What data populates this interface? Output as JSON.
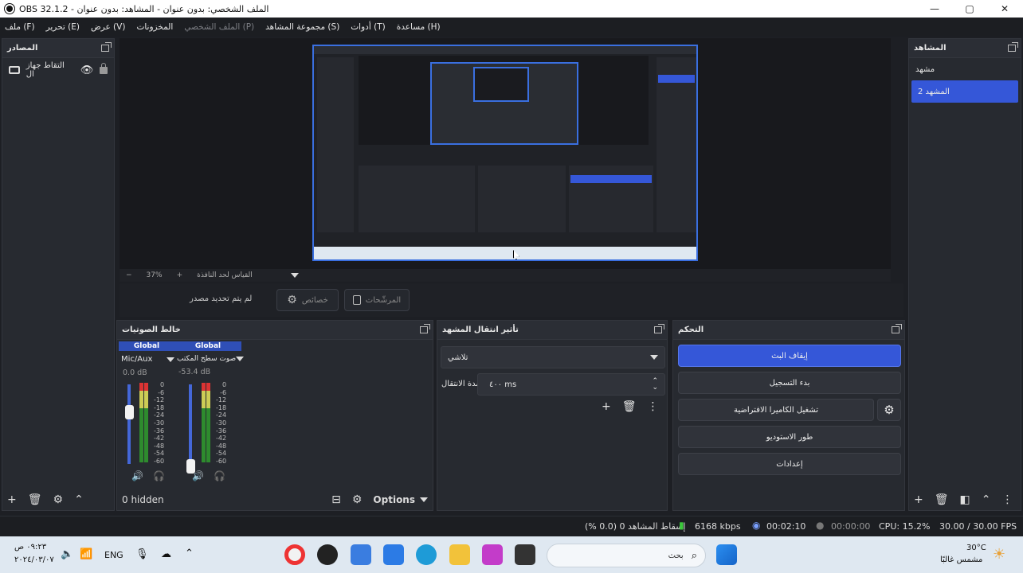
{
  "window": {
    "title": "OBS 32.1.2 - الملف الشخصي: بدون عنوان - المشاهد: بدون عنوان",
    "min_glyph": "—",
    "max_glyph": "▢",
    "close_glyph": "✕"
  },
  "menu": [
    {
      "label": "ملف (F)",
      "enabled": true
    },
    {
      "label": "تحرير (E)",
      "enabled": true
    },
    {
      "label": "عرض (V)",
      "enabled": true
    },
    {
      "label": "المخزونات",
      "enabled": true
    },
    {
      "label": "الملف الشخصي (P)",
      "enabled": false
    },
    {
      "label": "مجموعة المشاهد (S)",
      "enabled": true
    },
    {
      "label": "أدوات (T)",
      "enabled": true
    },
    {
      "label": "مساعدة (H)",
      "enabled": true
    }
  ],
  "sources": {
    "title": "المصادر",
    "items": [
      {
        "label": "التقاط جهاز ال",
        "icon": "monitor-icon"
      }
    ],
    "footer_hidden": "0 hidden"
  },
  "preview": {
    "zoom": "37%",
    "scale_label": "القياس لحد النافذة"
  },
  "context": {
    "no_source": "لم يتم تحديد مصدر",
    "properties": "خصائص",
    "filters": "المرشّحات"
  },
  "mixer": {
    "title": "خالط الصوتيات",
    "channels": [
      {
        "tag": "Global",
        "name": "Mic/Aux",
        "db": "0.0 dB",
        "level": 1.0
      },
      {
        "tag": "Global",
        "name": "صوت سطح المكتب",
        "db": "-53.4 dB",
        "level": 0.27
      }
    ],
    "scale": [
      "0",
      "-6",
      "-12",
      "-18",
      "-24",
      "-30",
      "-36",
      "-42",
      "-48",
      "-54",
      "-60"
    ],
    "options_label": "Options"
  },
  "transitions": {
    "title": "تأثير انتقال المشهد",
    "selected": "تلاشي",
    "duration_label": "مدة الانتقال",
    "duration_value": "٤٠٠ ms"
  },
  "controls": {
    "title": "التحكم",
    "stop_stream": "إيقاف البث",
    "start_record": "بدء التسجيل",
    "virtual_cam": "تشغيل الكاميرا الافتراضية",
    "studio_mode": "طور الاستوديو",
    "settings": "إعدادات"
  },
  "scenes": {
    "title": "المشاهد",
    "items": [
      {
        "label": "مشهد",
        "active": false
      },
      {
        "label": "المشهد 2",
        "active": true
      }
    ]
  },
  "status": {
    "dropped": "إسقاط المشاهد 0 (0.0 %)",
    "bitrate": "6168 kbps",
    "stream_time": "00:02:10",
    "record_time": "00:00:00",
    "cpu": "CPU: 15.2%",
    "fps": "30.00 / 30.00 FPS"
  },
  "taskbar": {
    "weather_temp": "30°C",
    "weather_desc": "مشمس غالبًا",
    "search_placeholder": "بحث",
    "lang": "ENG",
    "time": "٠٩:٢٣ ص",
    "date": "٢٠٢٤/٠٣/٠٧"
  }
}
